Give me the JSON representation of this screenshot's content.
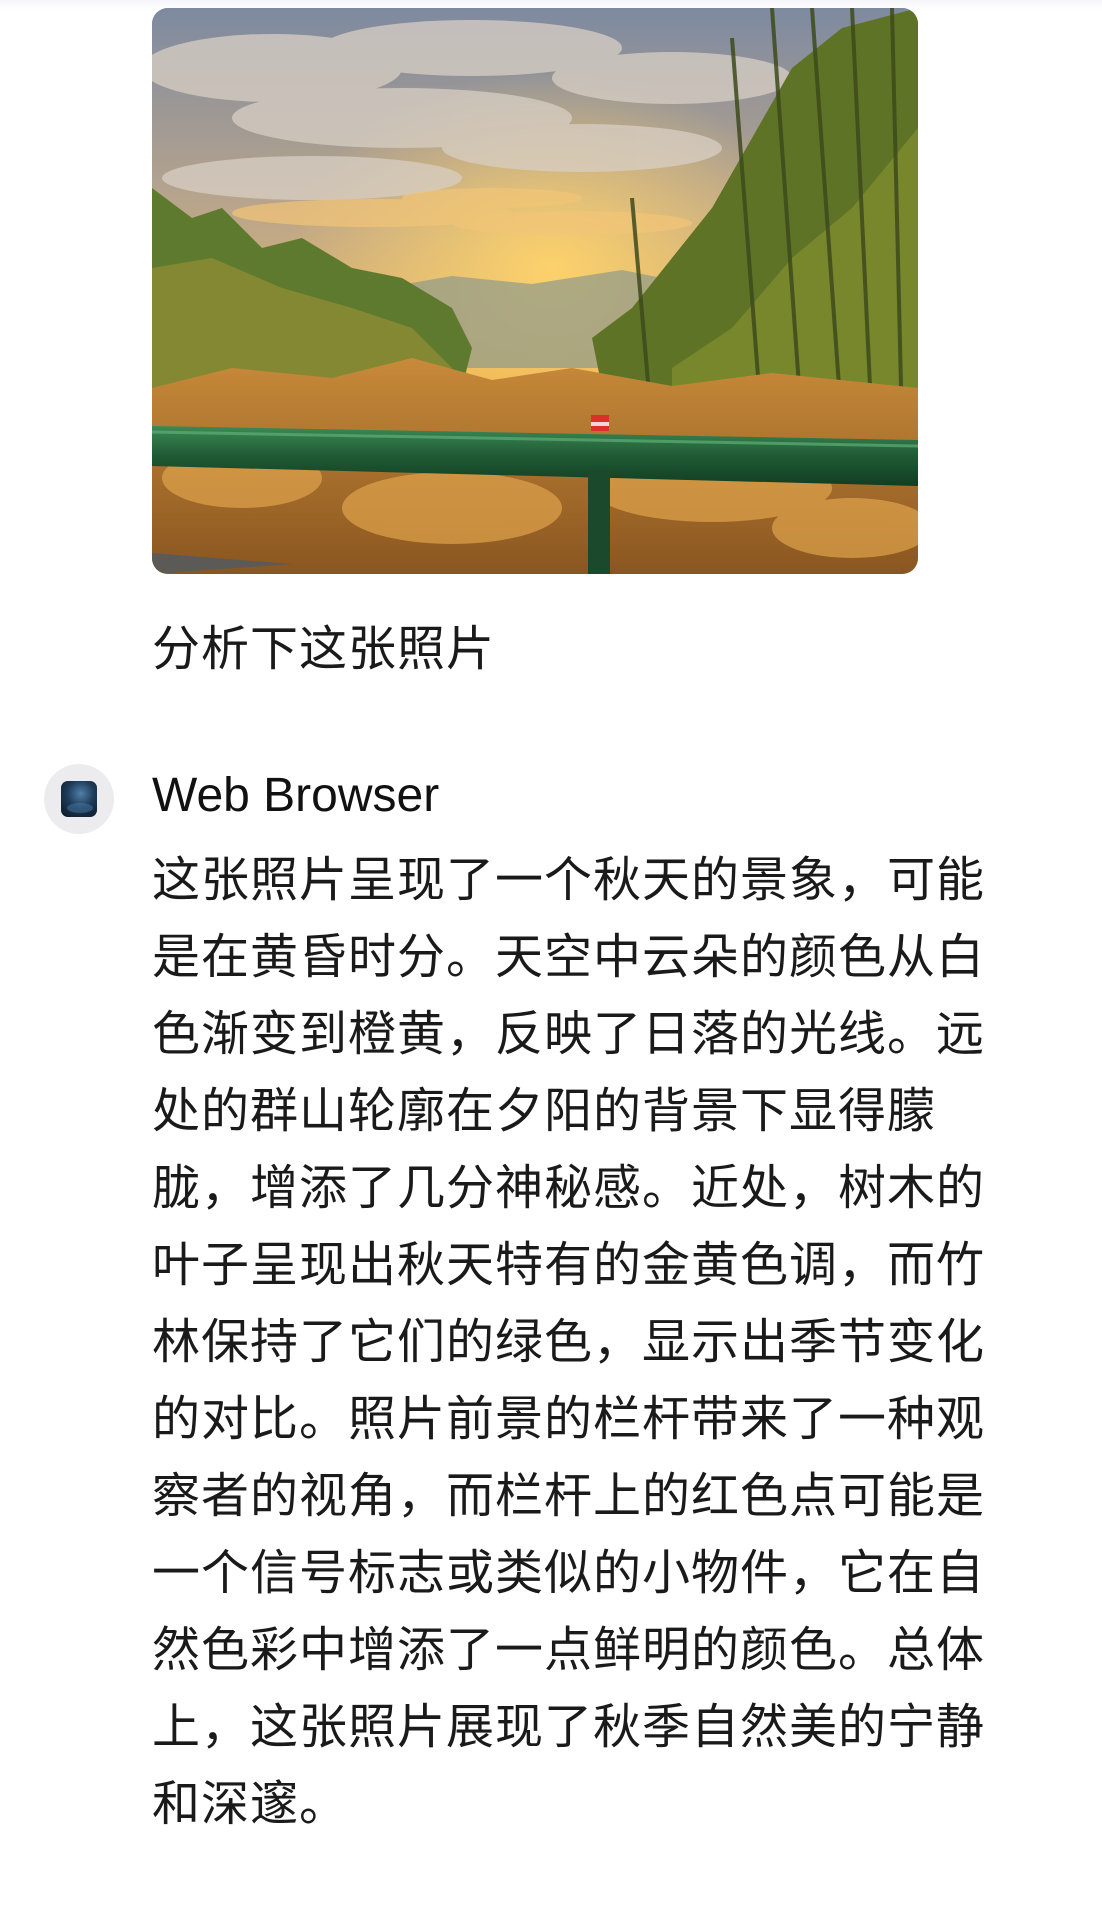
{
  "chat": {
    "user": {
      "attachment": {
        "type": "photo",
        "subject": "autumn sunset over bamboo forest with green guardrail"
      },
      "message": "分析下这张照片"
    },
    "assistant": {
      "name": "Web Browser",
      "avatar_icon": "globe-avatar-icon",
      "lines": [
        "这张照片呈现了一个秋天的景象，可能",
        "是在黄昏时分。天空中云朵的颜色从白",
        "色渐变到橙黄，反映了日落的光线。远",
        "处的群山轮廓在夕阳的背景下显得朦",
        "胧，增添了几分神秘感。近处，树木的",
        "叶子呈现出秋天特有的金黄色调，而竹",
        "林保持了它们的绿色，显示出季节变化",
        "的对比。照片前景的栏杆带来了一种观",
        "察者的视角，而栏杆上的红色点可能是",
        "一个信号标志或类似的小物件，它在自",
        "然色彩中增添了一点鲜明的颜色。总体",
        "上，这张照片展现了秋季自然美的宁静",
        "和深邃。"
      ]
    }
  },
  "colors": {
    "text": "#1a1a1a",
    "avatar_bg": "#ececee",
    "guardrail": "#1f5a34",
    "sunset": "#f5a623"
  }
}
